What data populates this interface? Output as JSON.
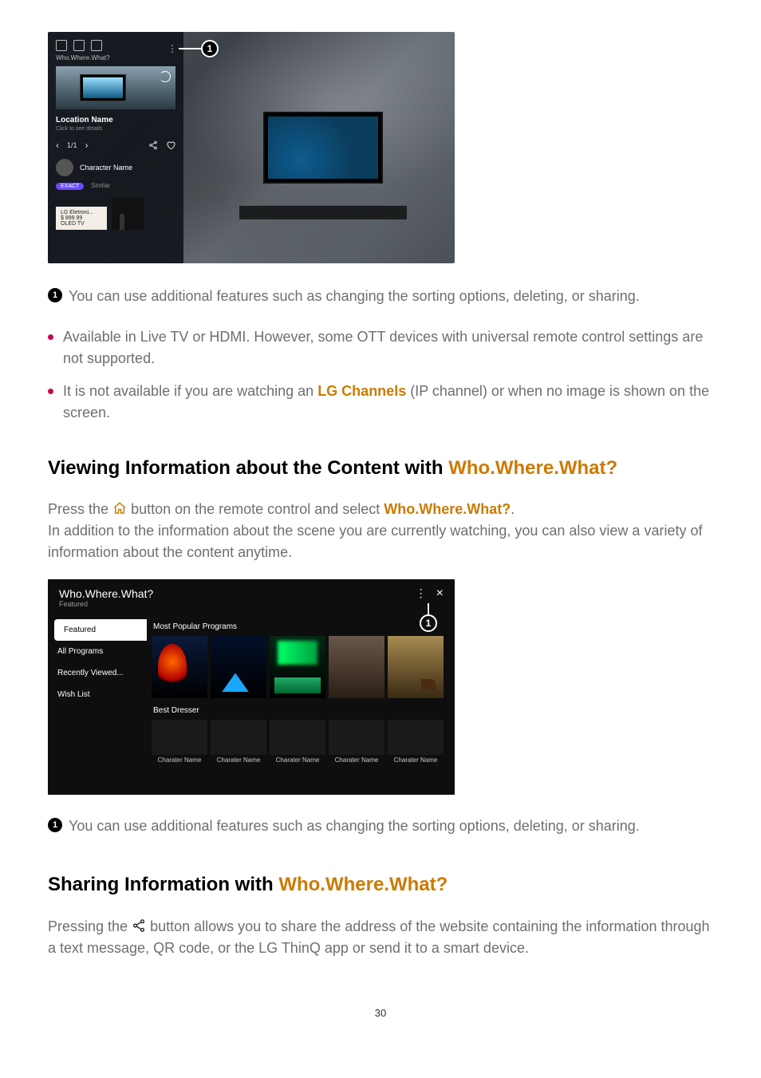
{
  "page_number": "30",
  "fig1": {
    "callout_label": "1",
    "panel_title_small": "Who.Where.What?",
    "location_label": "Location Name",
    "location_sub": "Click to see details",
    "counter": "1/1",
    "character_label": "Character Name",
    "badge": "EXACT",
    "similar": "Similar",
    "product_name": "LG Eletroni...",
    "product_price": "$ 899.99",
    "product_type": "OLED TV"
  },
  "num_item_1": "You can use additional features such as changing the sorting options, deleting, or sharing.",
  "bullets": [
    {
      "text_a": "Available in Live TV or HDMI. However, some OTT devices with universal remote control settings are not supported."
    },
    {
      "text_a": "It is not available if you are watching an ",
      "em": "LG Channels",
      "text_b": " (IP channel) or when no image is shown on the screen."
    }
  ],
  "heading1": {
    "plain": "Viewing Information about the Content with ",
    "orange": "Who.Where.What?"
  },
  "para1": {
    "a": "Press the ",
    "b": " button on the remote control and select ",
    "c": "Who.Where.What?",
    "d": ".",
    "e": "In addition to the information about the scene you are currently watching, you can also view a variety of information about the content anytime."
  },
  "fig2": {
    "title": "Who.Where.What?",
    "subtitle": "Featured",
    "close": "×",
    "callout_label": "1",
    "tabs": [
      "Featured",
      "All Programs",
      "Recently Viewed...",
      "Wish List"
    ],
    "row1_title": "Most Popular Programs",
    "row2_title": "Best Dresser",
    "char_label": "Charater Name"
  },
  "num_item_2": "You can use additional features such as changing the sorting options, deleting, or sharing.",
  "heading2": {
    "plain": "Sharing Information with ",
    "orange": "Who.Where.What?"
  },
  "para2": {
    "a": "Pressing the ",
    "b": " button allows you to share the address of the website containing the information through a text message, QR code, or the LG ThinQ app or send it to a smart device."
  }
}
